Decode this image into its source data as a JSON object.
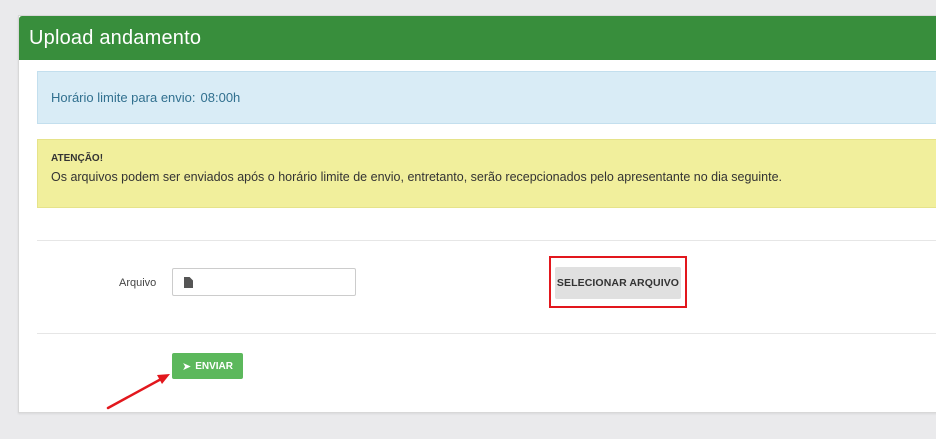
{
  "header": {
    "title": "Upload andamento"
  },
  "info_alert": {
    "label": "Horário limite para envio:",
    "time": "08:00h"
  },
  "warning_alert": {
    "title": "ATENÇÃO!",
    "message": "Os arquivos podem ser enviados após o horário limite de envio, entretanto, serão recepcionados pelo apresentante no dia seguinte."
  },
  "form": {
    "file_label": "Arquivo",
    "select_button": "SELECIONAR ARQUIVO",
    "send_button": "ENVIAR"
  },
  "colors": {
    "header_green": "#388e3c",
    "send_green": "#5cb85c",
    "annotation_red": "#e2171d"
  },
  "icons": {
    "file": "file-icon",
    "send": "paper-plane-icon",
    "annotation": "arrow-annotation"
  }
}
